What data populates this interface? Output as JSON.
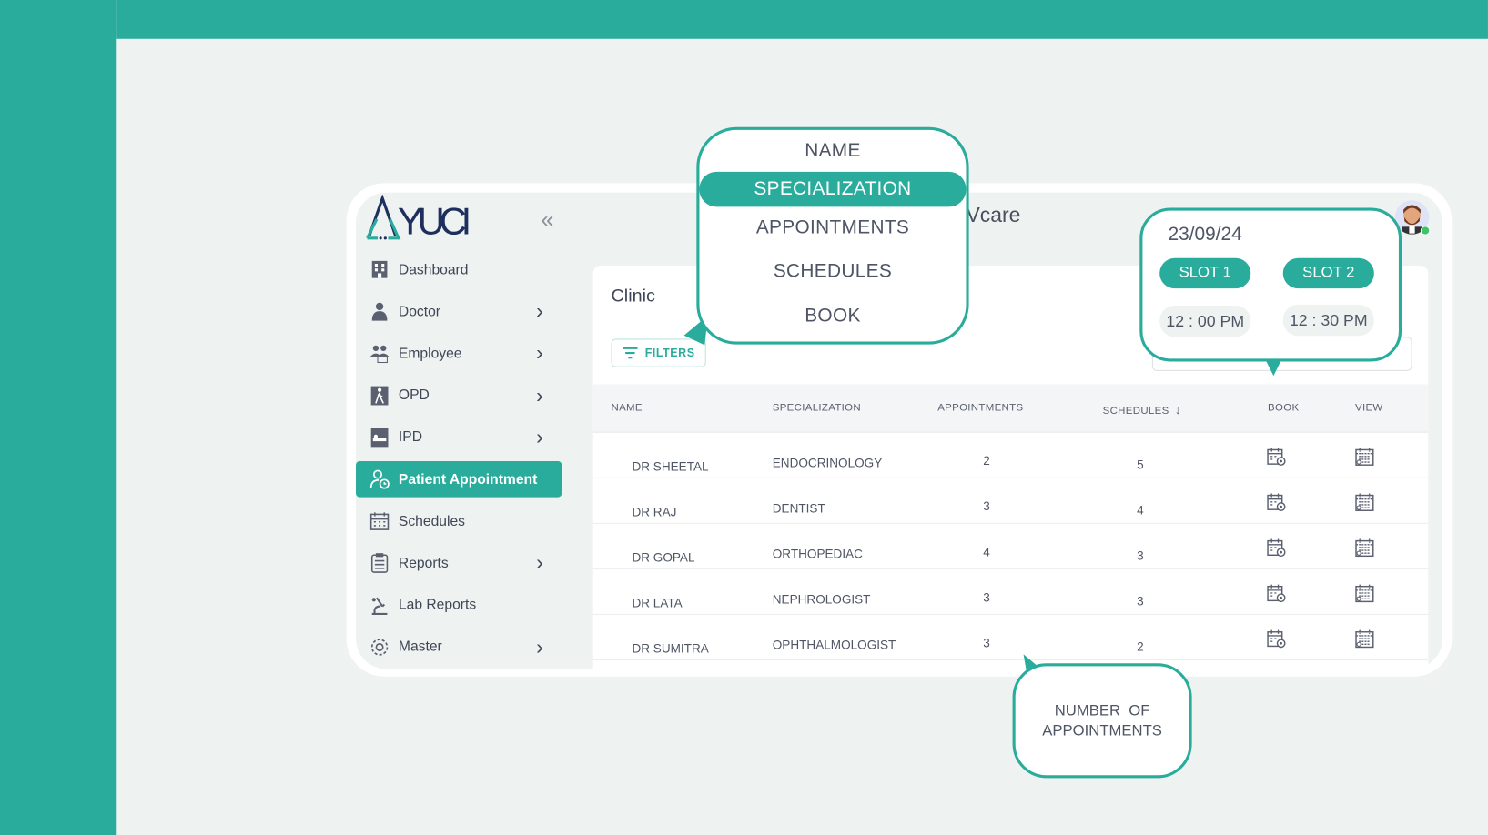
{
  "app": {
    "logo_text": "AYUCI",
    "header_title": "Vcare",
    "collapse_icon": "double-chevron-left-icon"
  },
  "colors": {
    "brand": "#2aac9c",
    "background": "#eef2f0",
    "text": "#4f5565"
  },
  "sidebar": {
    "items": [
      {
        "label": "Dashboard",
        "icon": "hospital-building-icon",
        "has_children": false,
        "active": false
      },
      {
        "label": "Doctor",
        "icon": "doctor-icon",
        "has_children": true,
        "active": false
      },
      {
        "label": "Employee",
        "icon": "employees-icon",
        "has_children": true,
        "active": false
      },
      {
        "label": "OPD",
        "icon": "walking-person-icon",
        "has_children": true,
        "active": false
      },
      {
        "label": "IPD",
        "icon": "hospital-bed-icon",
        "has_children": true,
        "active": false
      },
      {
        "label": "Patient Appointment",
        "icon": "patient-clock-icon",
        "has_children": false,
        "active": true
      },
      {
        "label": "Schedules",
        "icon": "calendar-icon",
        "has_children": false,
        "active": false
      },
      {
        "label": "Reports",
        "icon": "clipboard-icon",
        "has_children": true,
        "active": false
      },
      {
        "label": "Lab Reports",
        "icon": "microscope-icon",
        "has_children": false,
        "active": false
      },
      {
        "label": "Master",
        "icon": "gear-icon",
        "has_children": true,
        "active": false
      }
    ]
  },
  "main": {
    "section_title": "Clinic",
    "filters_label": "FILTERS",
    "table": {
      "columns": [
        "NAME",
        "SPECIALIZATION",
        "APPOINTMENTS",
        "SCHEDULES",
        "BOOK",
        "VIEW"
      ],
      "sort_column": "SCHEDULES",
      "rows": [
        {
          "name": "DR  SHEETAL",
          "specialization": "ENDOCRINOLOGY",
          "appointments": "2",
          "schedules": "5"
        },
        {
          "name": "DR RAJ",
          "specialization": "DENTIST",
          "appointments": "3",
          "schedules": "4"
        },
        {
          "name": "DR GOPAL",
          "specialization": "ORTHOPEDIAC",
          "appointments": "4",
          "schedules": "3"
        },
        {
          "name": "DR LATA",
          "specialization": "NEPHROLOGIST",
          "appointments": "3",
          "schedules": "3"
        },
        {
          "name": "DR SUMITRA",
          "specialization": "OPHTHALMOLOGIST",
          "appointments": "3",
          "schedules": "2"
        }
      ]
    }
  },
  "callouts": {
    "columns_menu": {
      "items": [
        "NAME",
        "SPECIALIZATION",
        "APPOINTMENTS",
        "SCHEDULES",
        "BOOK"
      ],
      "highlighted": "SPECIALIZATION"
    },
    "slots": {
      "date": "23/09/24",
      "slots": [
        {
          "label": "SLOT 1",
          "time": "12 : 00 PM"
        },
        {
          "label": "SLOT 2",
          "time": "12 : 30 PM"
        }
      ]
    },
    "appointments_note": {
      "line1": "NUMBER  OF",
      "line2": "APPOINTMENTS"
    }
  }
}
